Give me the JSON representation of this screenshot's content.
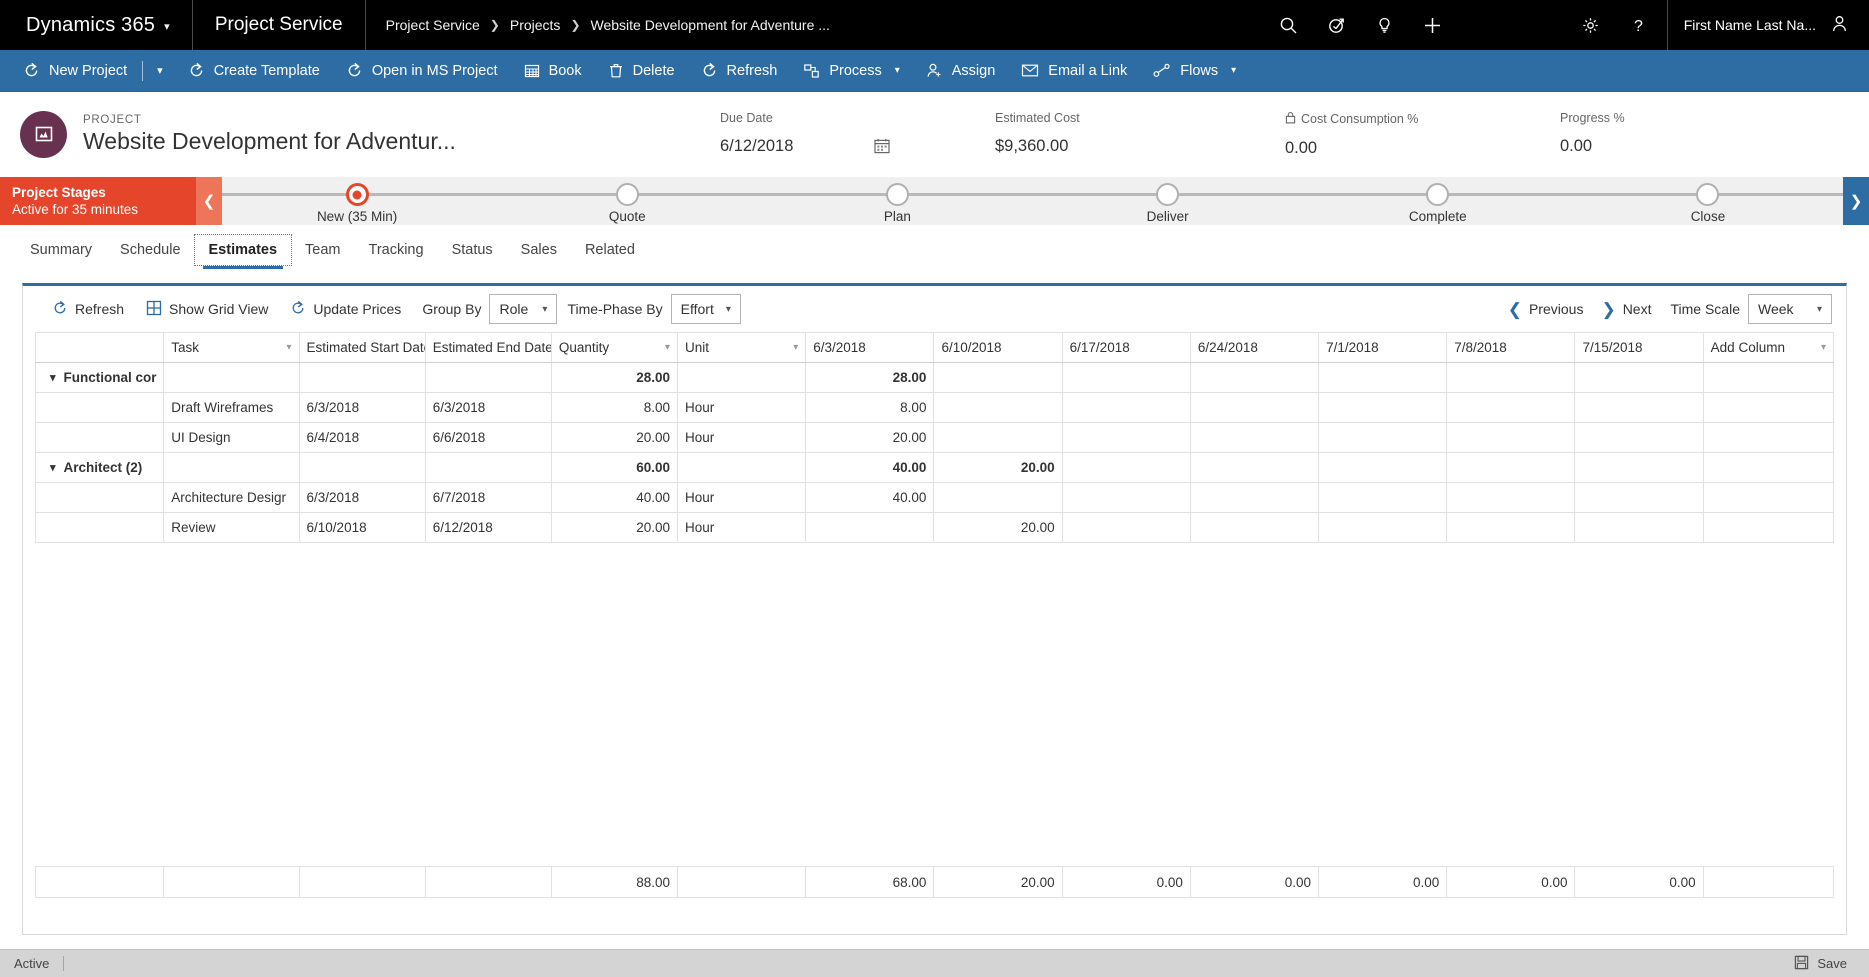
{
  "topnav": {
    "brand": "Dynamics 365",
    "brand_caret_icon": "chevron-down-icon",
    "app_name": "Project Service",
    "breadcrumbs": [
      "Project Service",
      "Projects",
      "Website Development for Adventure ..."
    ],
    "breadcrumb_separator": "›",
    "icons": [
      "search-icon",
      "assistant-icon",
      "learning-bulb-icon",
      "quick-create-plus-icon",
      "settings-gear-icon",
      "help-question-icon"
    ],
    "user_name": "First Name Last Na...",
    "user_avatar_icon": "person-icon"
  },
  "commandbar": {
    "items": [
      {
        "label": "New Project",
        "icon": "new-record-icon",
        "has_split_caret": true
      },
      {
        "label": "Create Template",
        "icon": "new-record-icon",
        "has_split_caret": false
      },
      {
        "label": "Open in MS Project",
        "icon": "new-record-icon",
        "has_split_caret": false
      },
      {
        "label": "Book",
        "icon": "grid-icon",
        "has_split_caret": false
      },
      {
        "label": "Delete",
        "icon": "trash-icon",
        "has_split_caret": false
      },
      {
        "label": "Refresh",
        "icon": "refresh-icon",
        "has_split_caret": false
      },
      {
        "label": "Process",
        "icon": "process-icon",
        "has_split_caret": false,
        "caret": "⌄"
      },
      {
        "label": "Assign",
        "icon": "assign-person-icon",
        "has_split_caret": false
      },
      {
        "label": "Email a Link",
        "icon": "email-link-icon",
        "has_split_caret": false
      },
      {
        "label": "Flows",
        "icon": "flows-icon",
        "has_split_caret": false,
        "caret": "⌄"
      }
    ]
  },
  "record_header": {
    "entity_label": "PROJECT",
    "title": "Website Development for Adventur...",
    "avatar_icon": "project-entity-icon",
    "avatar_color": "#68314f",
    "metrics": [
      {
        "label": "Due Date",
        "value": "6/12/2018",
        "icon": null,
        "trailing_icon": "calendar-icon"
      },
      {
        "label": "Estimated Cost",
        "value": "$9,360.00",
        "icon": null,
        "trailing_icon": null
      },
      {
        "label": "Cost Consumption %",
        "value": "0.00",
        "icon": "lock-icon",
        "trailing_icon": null
      },
      {
        "label": "Progress %",
        "value": "0.00",
        "icon": null,
        "trailing_icon": null
      }
    ]
  },
  "bpf": {
    "title": "Project Stages",
    "subtitle": "Active for 35 minutes",
    "collapse_icon": "chevron-left-icon",
    "next_icon": "chevron-right-icon",
    "accent_color": "#e4452b",
    "stages": [
      {
        "label": "New  (35 Min)",
        "active": true
      },
      {
        "label": "Quote",
        "active": false
      },
      {
        "label": "Plan",
        "active": false
      },
      {
        "label": "Deliver",
        "active": false
      },
      {
        "label": "Complete",
        "active": false
      },
      {
        "label": "Close",
        "active": false
      }
    ]
  },
  "form_tabs": [
    {
      "label": "Summary",
      "active": false
    },
    {
      "label": "Schedule",
      "active": false
    },
    {
      "label": "Estimates",
      "active": true
    },
    {
      "label": "Team",
      "active": false
    },
    {
      "label": "Tracking",
      "active": false
    },
    {
      "label": "Status",
      "active": false
    },
    {
      "label": "Sales",
      "active": false
    },
    {
      "label": "Related",
      "active": false
    }
  ],
  "grid_toolbar": {
    "refresh": {
      "label": "Refresh",
      "icon": "refresh-icon"
    },
    "show_grid_view": {
      "label": "Show Grid View",
      "icon": "grid-view-icon"
    },
    "update_prices": {
      "label": "Update Prices",
      "icon": "refresh-icon"
    },
    "group_by_label": "Group By",
    "group_by_value": "Role",
    "time_phase_label": "Time-Phase By",
    "time_phase_value": "Effort",
    "previous": {
      "label": "Previous",
      "icon": "chevron-left-icon"
    },
    "next": {
      "label": "Next",
      "icon": "chevron-right-icon"
    },
    "time_scale_label": "Time Scale",
    "time_scale_value": "Week",
    "caret_icon": "chevron-down-icon"
  },
  "grid": {
    "columns": [
      {
        "key": "handle",
        "label": "",
        "sortable": false,
        "align": "left"
      },
      {
        "key": "task",
        "label": "Task",
        "sortable": true,
        "align": "left"
      },
      {
        "key": "esd",
        "label": "Estimated Start Date",
        "sortable": true,
        "align": "left"
      },
      {
        "key": "eed",
        "label": "Estimated End Date",
        "sortable": true,
        "align": "left"
      },
      {
        "key": "qty",
        "label": "Quantity",
        "sortable": true,
        "align": "right"
      },
      {
        "key": "unit",
        "label": "Unit",
        "sortable": true,
        "align": "left"
      },
      {
        "key": "w1",
        "label": "6/3/2018",
        "sortable": false,
        "align": "right"
      },
      {
        "key": "w2",
        "label": "6/10/2018",
        "sortable": false,
        "align": "right"
      },
      {
        "key": "w3",
        "label": "6/17/2018",
        "sortable": false,
        "align": "right"
      },
      {
        "key": "w4",
        "label": "6/24/2018",
        "sortable": false,
        "align": "right"
      },
      {
        "key": "w5",
        "label": "7/1/2018",
        "sortable": false,
        "align": "right"
      },
      {
        "key": "w6",
        "label": "7/8/2018",
        "sortable": false,
        "align": "right"
      },
      {
        "key": "w7",
        "label": "7/15/2018",
        "sortable": false,
        "align": "right"
      },
      {
        "key": "add",
        "label": "Add Column",
        "sortable": true,
        "align": "left"
      }
    ],
    "rows": [
      {
        "type": "group",
        "expand_icon": "chevron-down-icon",
        "group_label": "Functional cor",
        "task": "",
        "esd": "",
        "eed": "",
        "qty": "28.00",
        "unit": "",
        "w1": "28.00",
        "w2": "",
        "w3": "",
        "w4": "",
        "w5": "",
        "w6": "",
        "w7": "",
        "add": ""
      },
      {
        "type": "task",
        "expand_icon": null,
        "group_label": "",
        "task": "Draft Wireframes",
        "esd": "6/3/2018",
        "eed": "6/3/2018",
        "qty": "8.00",
        "unit": "Hour",
        "w1": "8.00",
        "w2": "",
        "w3": "",
        "w4": "",
        "w5": "",
        "w6": "",
        "w7": "",
        "add": ""
      },
      {
        "type": "task",
        "expand_icon": null,
        "group_label": "",
        "task": "UI Design",
        "esd": "6/4/2018",
        "eed": "6/6/2018",
        "qty": "20.00",
        "unit": "Hour",
        "w1": "20.00",
        "w2": "",
        "w3": "",
        "w4": "",
        "w5": "",
        "w6": "",
        "w7": "",
        "add": ""
      },
      {
        "type": "group",
        "expand_icon": "chevron-down-icon",
        "group_label": "Architect (2)",
        "task": "",
        "esd": "",
        "eed": "",
        "qty": "60.00",
        "unit": "",
        "w1": "40.00",
        "w2": "20.00",
        "w3": "",
        "w4": "",
        "w5": "",
        "w6": "",
        "w7": "",
        "add": ""
      },
      {
        "type": "task",
        "expand_icon": null,
        "group_label": "",
        "task": "Architecture Desigr",
        "esd": "6/3/2018",
        "eed": "6/7/2018",
        "qty": "40.00",
        "unit": "Hour",
        "w1": "40.00",
        "w2": "",
        "w3": "",
        "w4": "",
        "w5": "",
        "w6": "",
        "w7": "",
        "add": ""
      },
      {
        "type": "task",
        "expand_icon": null,
        "group_label": "",
        "task": "Review",
        "esd": "6/10/2018",
        "eed": "6/12/2018",
        "qty": "20.00",
        "unit": "Hour",
        "w1": "",
        "w2": "20.00",
        "w3": "",
        "w4": "",
        "w5": "",
        "w6": "",
        "w7": "",
        "add": ""
      }
    ],
    "totals": {
      "handle": "",
      "task": "",
      "esd": "",
      "eed": "",
      "qty": "88.00",
      "unit": "",
      "w1": "68.00",
      "w2": "20.00",
      "w3": "0.00",
      "w4": "0.00",
      "w5": "0.00",
      "w6": "0.00",
      "w7": "0.00",
      "add": ""
    }
  },
  "statusbar": {
    "status": "Active",
    "save_label": "Save",
    "save_icon": "save-disk-icon"
  }
}
